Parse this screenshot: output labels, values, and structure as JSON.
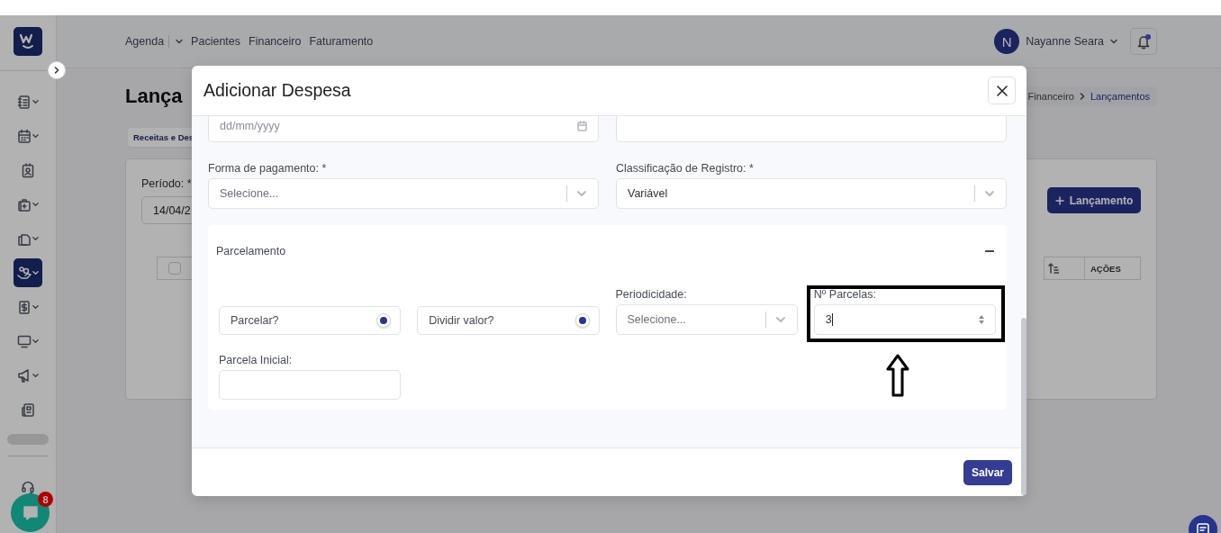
{
  "sidebar": {
    "items": [
      {
        "expandable": true,
        "selected": false
      },
      {
        "expandable": true,
        "selected": false
      },
      {
        "expandable": false,
        "selected": false
      },
      {
        "expandable": true,
        "selected": false
      },
      {
        "expandable": true,
        "selected": false
      },
      {
        "expandable": true,
        "selected": true
      },
      {
        "expandable": true,
        "selected": false
      },
      {
        "expandable": true,
        "selected": false
      },
      {
        "expandable": true,
        "selected": false
      },
      {
        "expandable": false,
        "selected": false
      }
    ]
  },
  "chat_widget": {
    "badge": "8"
  },
  "nav": {
    "items": [
      {
        "label": "Agenda",
        "has_dropdown": true
      },
      {
        "label": "Pacientes",
        "has_dropdown": false
      },
      {
        "label": "Financeiro",
        "has_dropdown": false
      },
      {
        "label": "Faturamento",
        "has_dropdown": false
      }
    ]
  },
  "user": {
    "initial": "N",
    "name": "Nayanne Seara"
  },
  "notifications": {
    "unread": true
  },
  "page": {
    "title": "Lança",
    "breadcrumb": [
      "Financeiro",
      "Lançamentos"
    ],
    "tabs": [
      {
        "label": "Receitas e Des",
        "selected": true
      }
    ],
    "period": {
      "label": "Período: *",
      "value": "14/04/2"
    },
    "add_button": "Lançamento",
    "table": {
      "columns": [
        {
          "kind": "checkbox",
          "checked": false
        },
        {
          "kind": "sort"
        },
        {
          "kind": "text",
          "label": "AÇÕES"
        }
      ]
    }
  },
  "modal": {
    "title": "Adicionar Despesa",
    "date": {
      "placeholder": "dd/mm/yyyy"
    },
    "payment": {
      "label": "Forma de pagamento: *",
      "placeholder": "Selecione..."
    },
    "classification": {
      "label": "Classificação de Registro: *",
      "value": "Variável"
    },
    "installments": {
      "title": "Parcelamento",
      "expanded": true,
      "toggles": [
        {
          "label": "Parcelar?",
          "checked": true
        },
        {
          "label": "Dividir valor?",
          "checked": true
        }
      ],
      "periodicity": {
        "label": "Periodicidade:",
        "placeholder": "Selecione..."
      },
      "count": {
        "label": "Nº Parcelas:",
        "value": "3"
      },
      "initial": {
        "label": "Parcela Inicial:"
      }
    },
    "save_button": "Salvar"
  }
}
